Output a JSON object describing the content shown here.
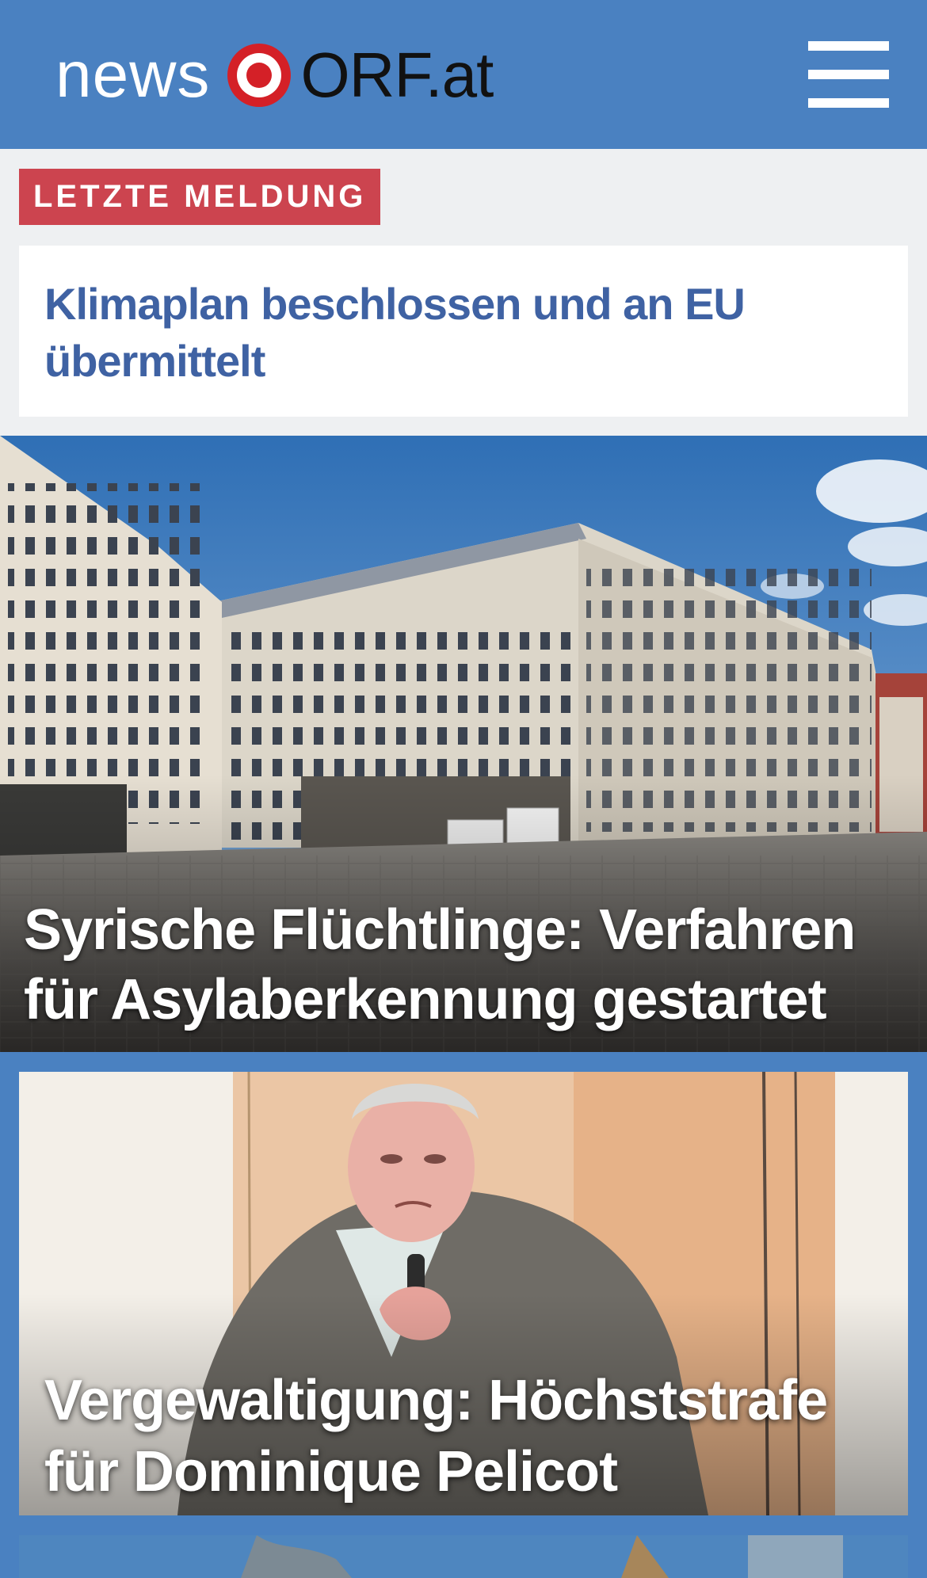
{
  "header": {
    "logo_news": "news",
    "logo_orf": "ORF.at",
    "menu_icon": "hamburger-menu-icon",
    "brand_color": "#4a81c1"
  },
  "breaking": {
    "badge": "LETZTE MELDUNG",
    "badge_color": "#cc444f",
    "title": "Klimaplan beschlossen und an EU übermittelt",
    "title_color": "#3f62a3"
  },
  "stories": [
    {
      "title": "Syrische Flüchtlinge: Verfahren für Asylaberkennung gestartet",
      "image": "building-plaza-photo"
    },
    {
      "title": "Vergewaltigung: Höchststrafe für Dominique Pelicot",
      "image": "courtroom-sketch"
    },
    {
      "image": "partial-photo"
    }
  ]
}
